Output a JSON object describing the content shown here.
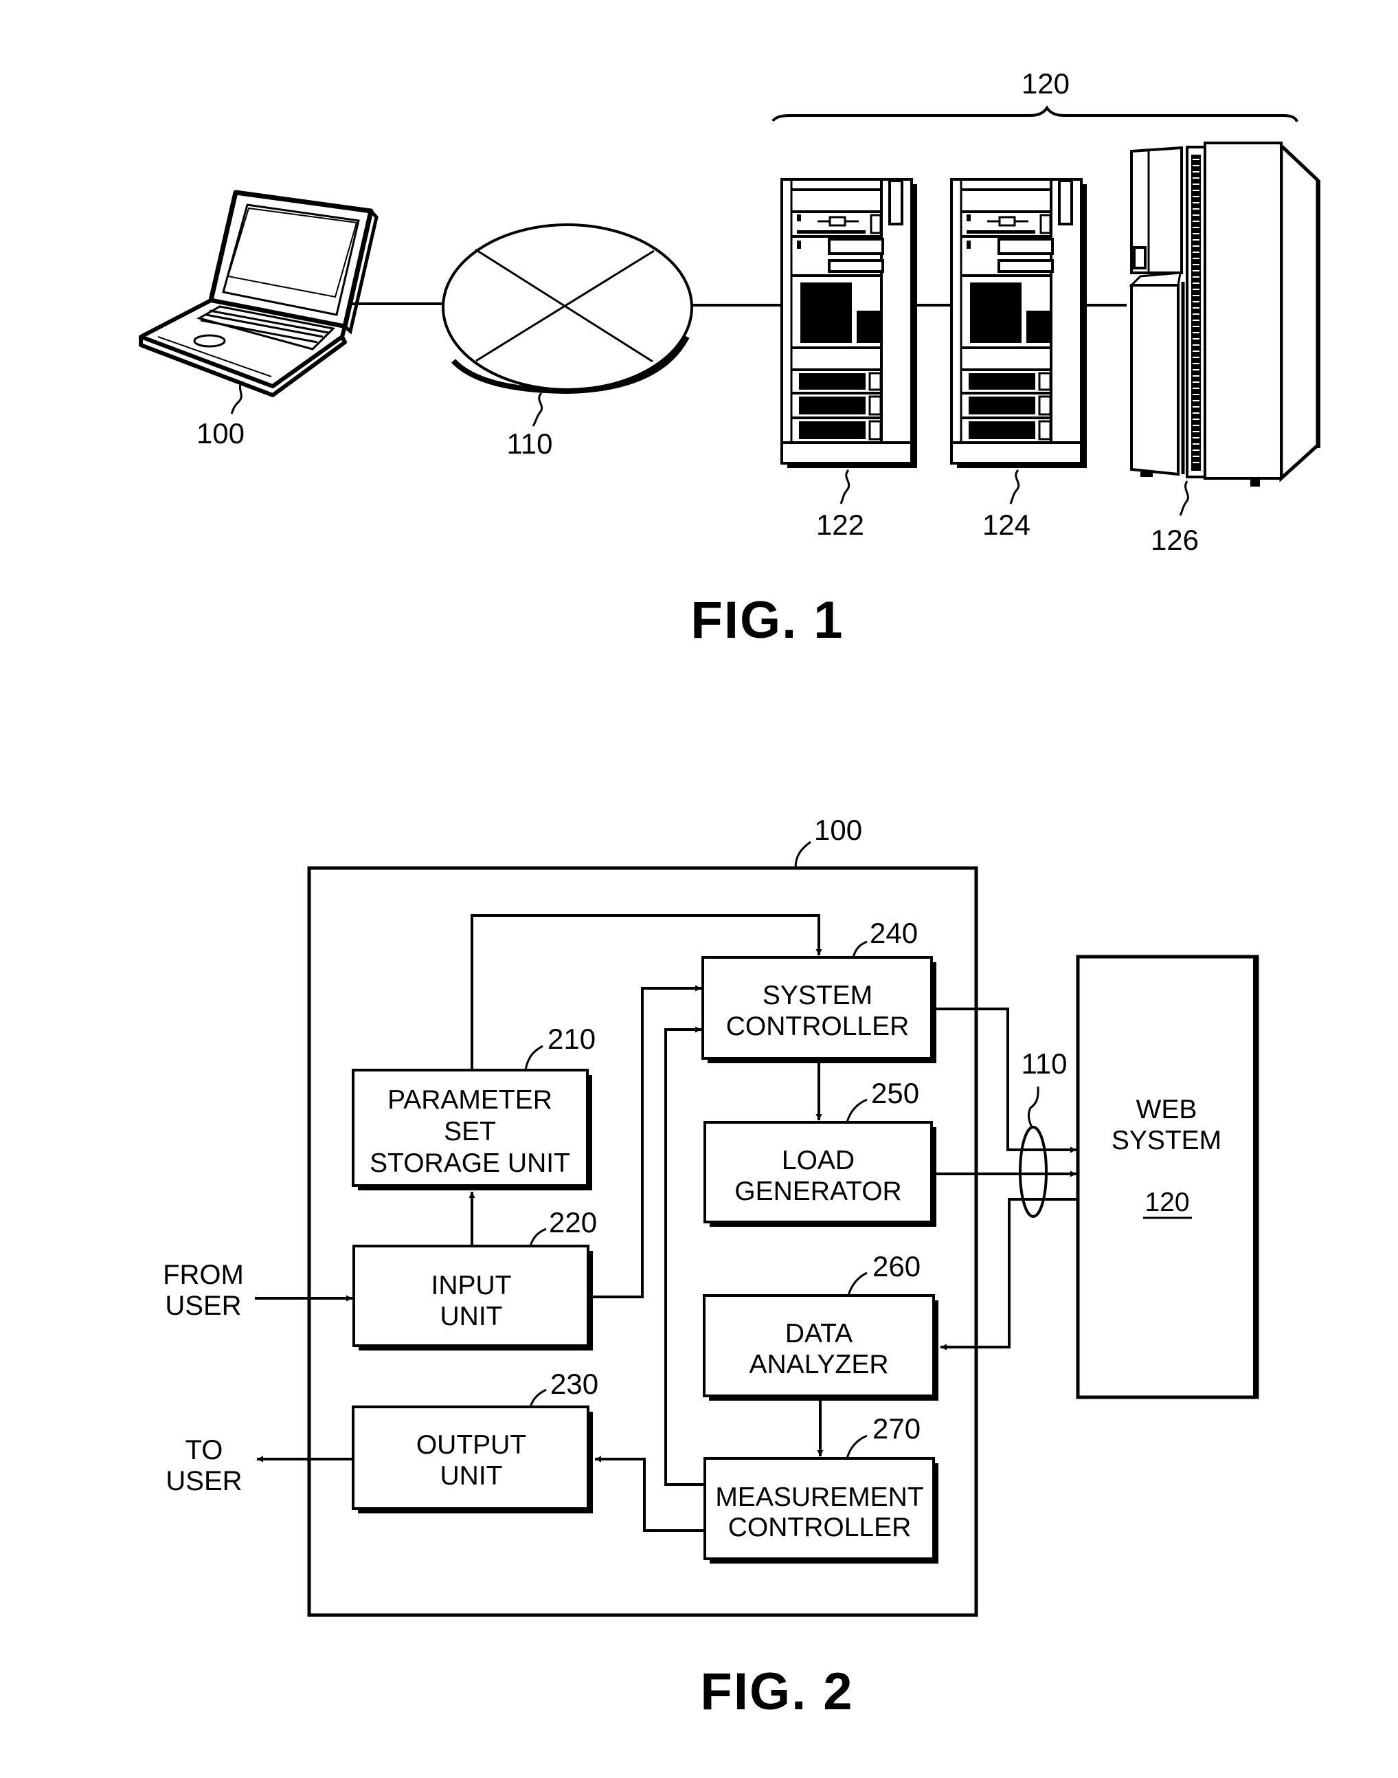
{
  "fig1": {
    "caption": "FIG. 1",
    "laptop_ref": "100",
    "network_ref": "110",
    "web_system_ref": "120",
    "server_refs": [
      "122",
      "124",
      "126"
    ]
  },
  "fig2": {
    "caption": "FIG. 2",
    "device_ref": "100",
    "network_ref": "110",
    "inputs": {
      "from_user": [
        "FROM",
        "USER"
      ],
      "to_user": [
        "TO",
        "USER"
      ]
    },
    "blocks": {
      "parameter_set_storage": {
        "ref": "210",
        "lines": [
          "PARAMETER",
          "SET",
          "STORAGE UNIT"
        ]
      },
      "input_unit": {
        "ref": "220",
        "lines": [
          "INPUT",
          "UNIT"
        ]
      },
      "output_unit": {
        "ref": "230",
        "lines": [
          "OUTPUT",
          "UNIT"
        ]
      },
      "system_controller": {
        "ref": "240",
        "lines": [
          "SYSTEM",
          "CONTROLLER"
        ]
      },
      "load_generator": {
        "ref": "250",
        "lines": [
          "LOAD",
          "GENERATOR"
        ]
      },
      "data_analyzer": {
        "ref": "260",
        "lines": [
          "DATA",
          "ANALYZER"
        ]
      },
      "measurement_controller": {
        "ref": "270",
        "lines": [
          "MEASUREMENT",
          "CONTROLLER"
        ]
      }
    },
    "web_system": {
      "lines": [
        "WEB",
        "SYSTEM"
      ],
      "ref": "120"
    }
  }
}
